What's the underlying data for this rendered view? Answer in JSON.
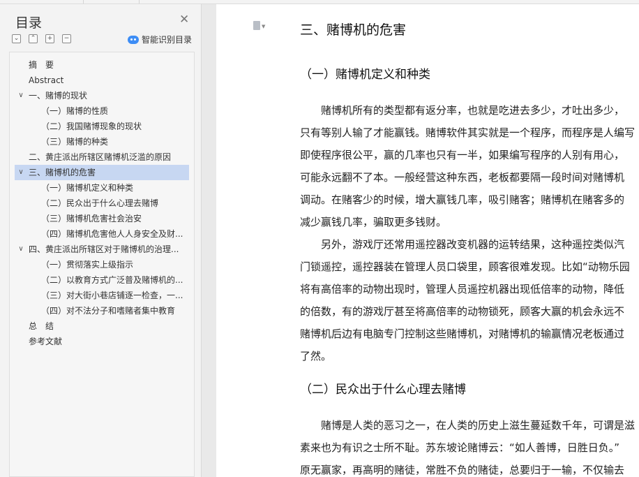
{
  "sidebar": {
    "title": "目录",
    "close_icon": "close-icon",
    "tool_icons": [
      "expand-all-icon",
      "collapse-up-icon",
      "expand-plus-icon",
      "collapse-minus-icon"
    ],
    "tool_glyphs": [
      "⌄",
      "⌃",
      "+",
      "−"
    ],
    "smart_label": "智能识别目录",
    "accent_color": "#3d8df5",
    "selected_color": "#c7d7f2",
    "items": [
      {
        "label": "摘　要"
      },
      {
        "label": "Abstract"
      },
      {
        "label": "一、赌博的现状",
        "arrow": "∨"
      },
      {
        "label": "（一）赌博的性质"
      },
      {
        "label": "（二）我国赌博现象的现状"
      },
      {
        "label": "（三）赌博的种类"
      },
      {
        "label": "二、黄庄派出所辖区赌博机泛滥的原因"
      },
      {
        "label": "三、赌博机的危害",
        "arrow": "∨"
      },
      {
        "label": "（一）赌博机定义和种类"
      },
      {
        "label": "（二）民众出于什么心理去赌博"
      },
      {
        "label": "（三）赌博机危害社会治安"
      },
      {
        "label": "（四）赌博机危害他人人身安全及财..."
      },
      {
        "label": "四、黄庄派出所辖区对于赌博机的治理...",
        "arrow": "∨"
      },
      {
        "label": "（一）贯彻落实上级指示"
      },
      {
        "label": "（二）以教育方式广泛普及赌博机的..."
      },
      {
        "label": "（三）对大街小巷店铺逐一检查，一..."
      },
      {
        "label": "（四）对不法分子和嗜赌者集中教育"
      },
      {
        "label": "总　结"
      },
      {
        "label": "参考文献"
      }
    ]
  },
  "document": {
    "page_icon": "document-icon",
    "heading": "三、赌博机的危害",
    "section1_heading": "（一）赌博机定义和种类",
    "section1_lines": [
      "　　赌博机所有的类型都有返分率，也就是吃进去多少，才吐出多少，",
      "只有等别人输了才能赢钱。赌博软件其实就是一个程序，而程序是人编写",
      "即使程序很公平，赢的几率也只有一半，如果编写程序的人别有用心，",
      "可能永远翻不了本。一般经营这种东西，老板都要隔一段时间对赌博机",
      "调动。在赌客少的时候，增大赢钱几率，吸引赌客；赌博机在赌客多的",
      "减少赢钱几率，骗取更多钱财。",
      "　　另外，游戏厅还常用遥控器改变机器的运转结果，这种遥控类似汽",
      "门锁遥控，遥控器装在管理人员口袋里，顾客很难发现。比如“动物乐园",
      "将有高倍率的动物出现时，管理人员遥控机器出现低倍率的动物，降低",
      "的倍数，有的游戏厅甚至将高倍率的动物锁死，顾客大赢的机会永远不",
      "赌博机后边有电脑专门控制这些赌博机，对赌博机的输赢情况老板通过",
      "了然。"
    ],
    "section2_heading": "（二）民众出于什么心理去赌博",
    "section2_lines": [
      "　　赌博是人类的恶习之一，在人类的历史上滋生蔓延数千年，可谓是滋",
      "素来也为有识之士所不耻。苏东坡论赌博云：“如人善博，日胜日负。”",
      "原无赢家，再高明的赌徒，常胜不负的赌徒，总要归于一输，不仅输去"
    ]
  }
}
